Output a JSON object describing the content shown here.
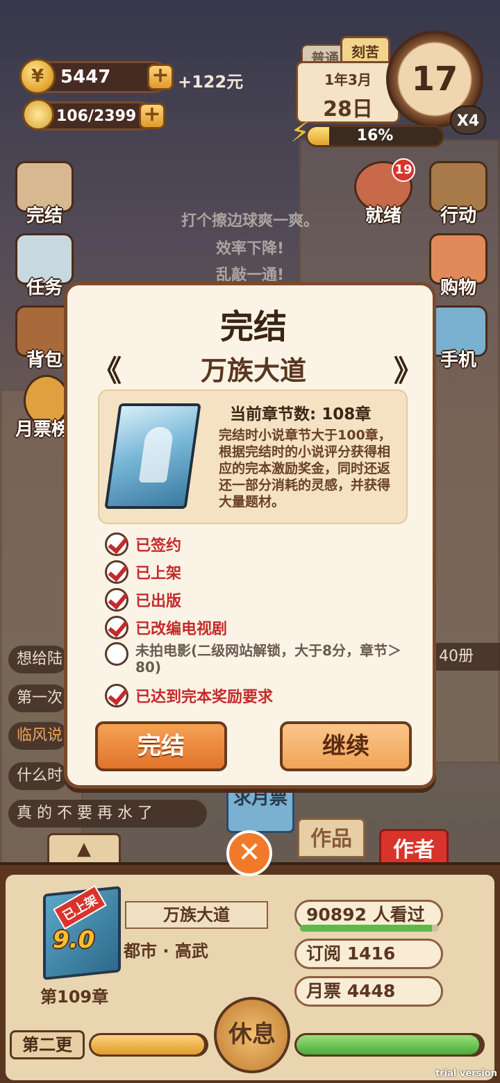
{
  "resources": {
    "coins": "5447",
    "coin_bonus": "+122元",
    "inspiration": "106/2399",
    "coin_icon_symbol": "¥",
    "plus": "+"
  },
  "calendar": {
    "mode_normal": "普通",
    "mode_hard": "刻苦",
    "year_month": "1年3月",
    "day": "28日",
    "clock_value": "17",
    "speed": "X4",
    "energy_percent": "16%",
    "energy_fraction": 0.16
  },
  "side_menu_left": [
    {
      "label": "完结"
    },
    {
      "label": "任务"
    },
    {
      "label": "背包"
    },
    {
      "label": "月票榜"
    }
  ],
  "side_menu_right": [
    {
      "label": "就绪",
      "badge": "19"
    },
    {
      "label": "行动"
    },
    {
      "label": "购物"
    },
    {
      "label": "手机"
    }
  ],
  "floating_messages": [
    "打个擦边球爽一爽。",
    "效率下降!",
    "乱敲一通!"
  ],
  "chat_lines": [
    "想给陆",
    "第一次",
    "临风说",
    "什么时",
    "真 的 不 要 再 水 了"
  ],
  "right_peek_text": "40册",
  "side_tabs": {
    "ask_ticket": "求月票",
    "works": "作品",
    "author": "作者",
    "up_arrow": "▲"
  },
  "modal": {
    "title": "完结",
    "prev_arrow": "《",
    "next_arrow": "》",
    "novel_name": "万族大道",
    "chapter_info": "当前章节数: 108章",
    "description": "完结时小说章节大于100章，根据完结时的小说评分获得相应的完本激励奖金，同时还返还一部分消耗的灵感，并获得大量题材。",
    "conditions": [
      {
        "text": "已签约",
        "checked": true
      },
      {
        "text": "已上架",
        "checked": true
      },
      {
        "text": "已出版",
        "checked": true
      },
      {
        "text": "已改编电视剧",
        "checked": true
      },
      {
        "text": "未拍电影(二级网站解锁，大于8分，章节＞80)",
        "checked": false
      },
      {
        "text": "已达到完本奖励要求",
        "checked": true
      }
    ],
    "finish_button": "完结",
    "continue_button": "继续",
    "close_symbol": "✕"
  },
  "bottom": {
    "book_status": "已上架",
    "book_score": "9.0",
    "chapter": "第109章",
    "novel_title": "万族大道",
    "genre": "都市 · 高武",
    "views": "90892  人看过",
    "views_fraction": 0.95,
    "subscriptions": "订阅 1416",
    "monthly_tickets": "月票 4448",
    "update_button": "第二更",
    "rest_button": "休息",
    "progress_left": 0.98,
    "progress_right": 0.98
  },
  "watermark": "trial version",
  "colors": {
    "accent_orange": "#e0742a",
    "check_red": "#c42a2a",
    "panel_brown": "#5a3620",
    "modal_bg": "#fbf3e6"
  }
}
